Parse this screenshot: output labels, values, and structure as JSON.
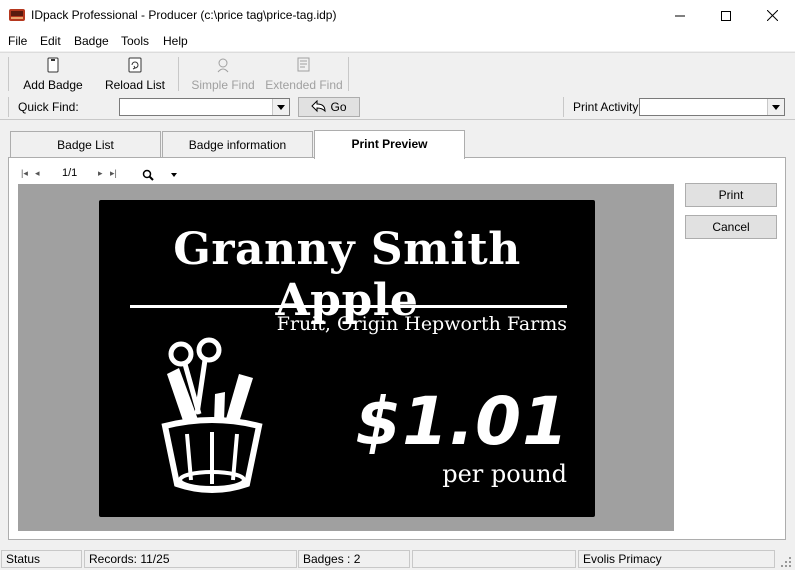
{
  "window": {
    "title": "IDpack Professional - Producer (c:\\price tag\\price-tag.idp)"
  },
  "menu": {
    "file": "File",
    "edit": "Edit",
    "badge": "Badge",
    "tools": "Tools",
    "help": "Help"
  },
  "toolbar": {
    "add_badge": "Add Badge",
    "reload_list": "Reload List",
    "simple_find": "Simple Find",
    "extended_find": "Extended Find"
  },
  "findbar": {
    "quick_find_label": "Quick Find:",
    "quick_find_value": "",
    "go_label": "Go",
    "print_activity_label": "Print Activity",
    "print_activity_value": ""
  },
  "tabs": [
    "Badge List",
    "Badge information",
    "Print Preview"
  ],
  "preview": {
    "page_indicator": "1/1",
    "badge": {
      "title": "Granny Smith Apple",
      "subtitle": "Fruit, Origin Hepworth Farms",
      "price": "$1.01",
      "unit": "per pound"
    },
    "print_button": "Print",
    "cancel_button": "Cancel"
  },
  "status": {
    "label": "Status",
    "records": "Records: 11/25",
    "badges": "Badges : 2",
    "empty": "",
    "printer": "Evolis Primacy"
  },
  "colors": {
    "badge_bg": "#000000",
    "preview_bg": "#a0a0a0",
    "app_icon": "#b5371e"
  }
}
